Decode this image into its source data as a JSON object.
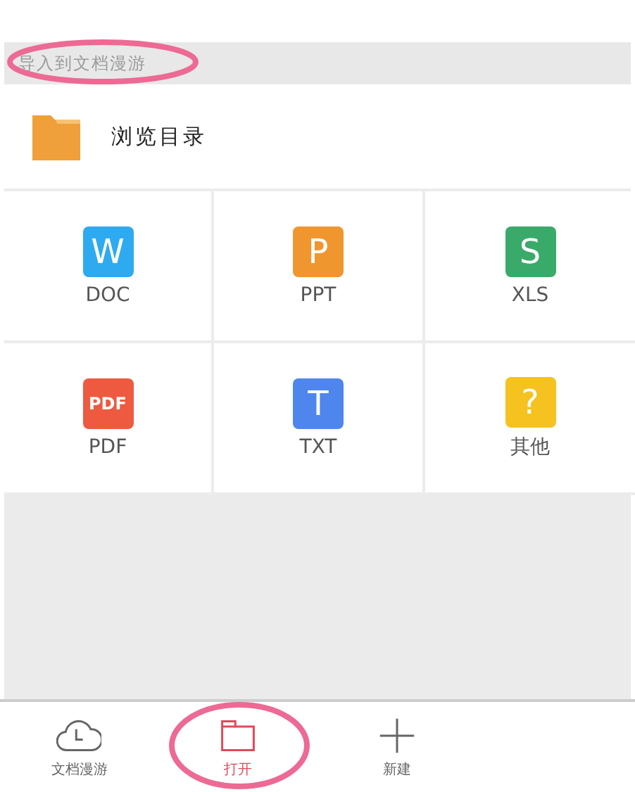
{
  "import_header": {
    "label": "导入到文档漫游",
    "circled": true
  },
  "browse": {
    "label": "浏览目录"
  },
  "formats": [
    {
      "kind": "doc",
      "glyph": "W",
      "label": "DOC",
      "color": "#2eaaf0"
    },
    {
      "kind": "ppt",
      "glyph": "P",
      "label": "PPT",
      "color": "#f0962e"
    },
    {
      "kind": "xls",
      "glyph": "S",
      "label": "XLS",
      "color": "#3aaa6a"
    },
    {
      "kind": "pdf",
      "glyph": "PDF",
      "label": "PDF",
      "color": "#ee5a40"
    },
    {
      "kind": "txt",
      "glyph": "T",
      "label": "TXT",
      "color": "#4f86ee"
    },
    {
      "kind": "other",
      "glyph": "?",
      "label": "其他",
      "color": "#f5c21f"
    }
  ],
  "tab_bar": [
    {
      "kind": "cloud",
      "label": "文档漫游",
      "selected": false,
      "circled": false
    },
    {
      "kind": "folder",
      "label": "打开",
      "selected": true,
      "circled": true
    },
    {
      "kind": "plus",
      "label": "新建",
      "selected": false,
      "circled": false
    }
  ]
}
